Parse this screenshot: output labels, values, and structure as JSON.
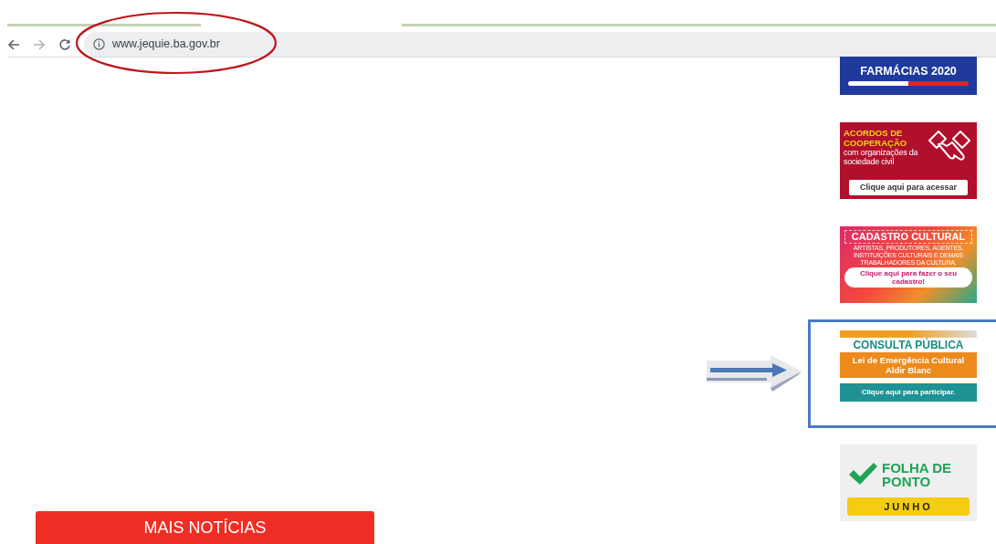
{
  "browser": {
    "url": "www.jequie.ba.gov.br"
  },
  "banners": [
    {
      "kind": "farmacias",
      "title": "FARMÁCIAS 2020",
      "highlighted": false
    },
    {
      "kind": "acordos",
      "title": "ACORDOS DE COOPERAÇÃO",
      "subtitle": "com organizações da sociedade civil",
      "action": "Clique aqui para acessar",
      "highlighted": false
    },
    {
      "kind": "cadastro",
      "title": "CADASTRO CULTURAL",
      "subtitle": "ARTISTAS, PRODUTORES, AGENTES, INSTITUIÇÕES CULTURAIS E DEMAIS TRABALHADORES DA CULTURA.",
      "action": "Clique aqui para fazer o seu cadastro!",
      "highlighted": false
    },
    {
      "kind": "consulta",
      "title": "CONSULTA PÚBLICA",
      "subtitle": "Lei de Emergência Cultural Aldir Blanc",
      "action": "Clique aqui para participar.",
      "highlighted": true
    },
    {
      "kind": "folha",
      "title": "FOLHA DE PONTO",
      "action": "JUNHO",
      "highlighted": false
    }
  ],
  "more_button": "MAIS NOTÍCIAS"
}
